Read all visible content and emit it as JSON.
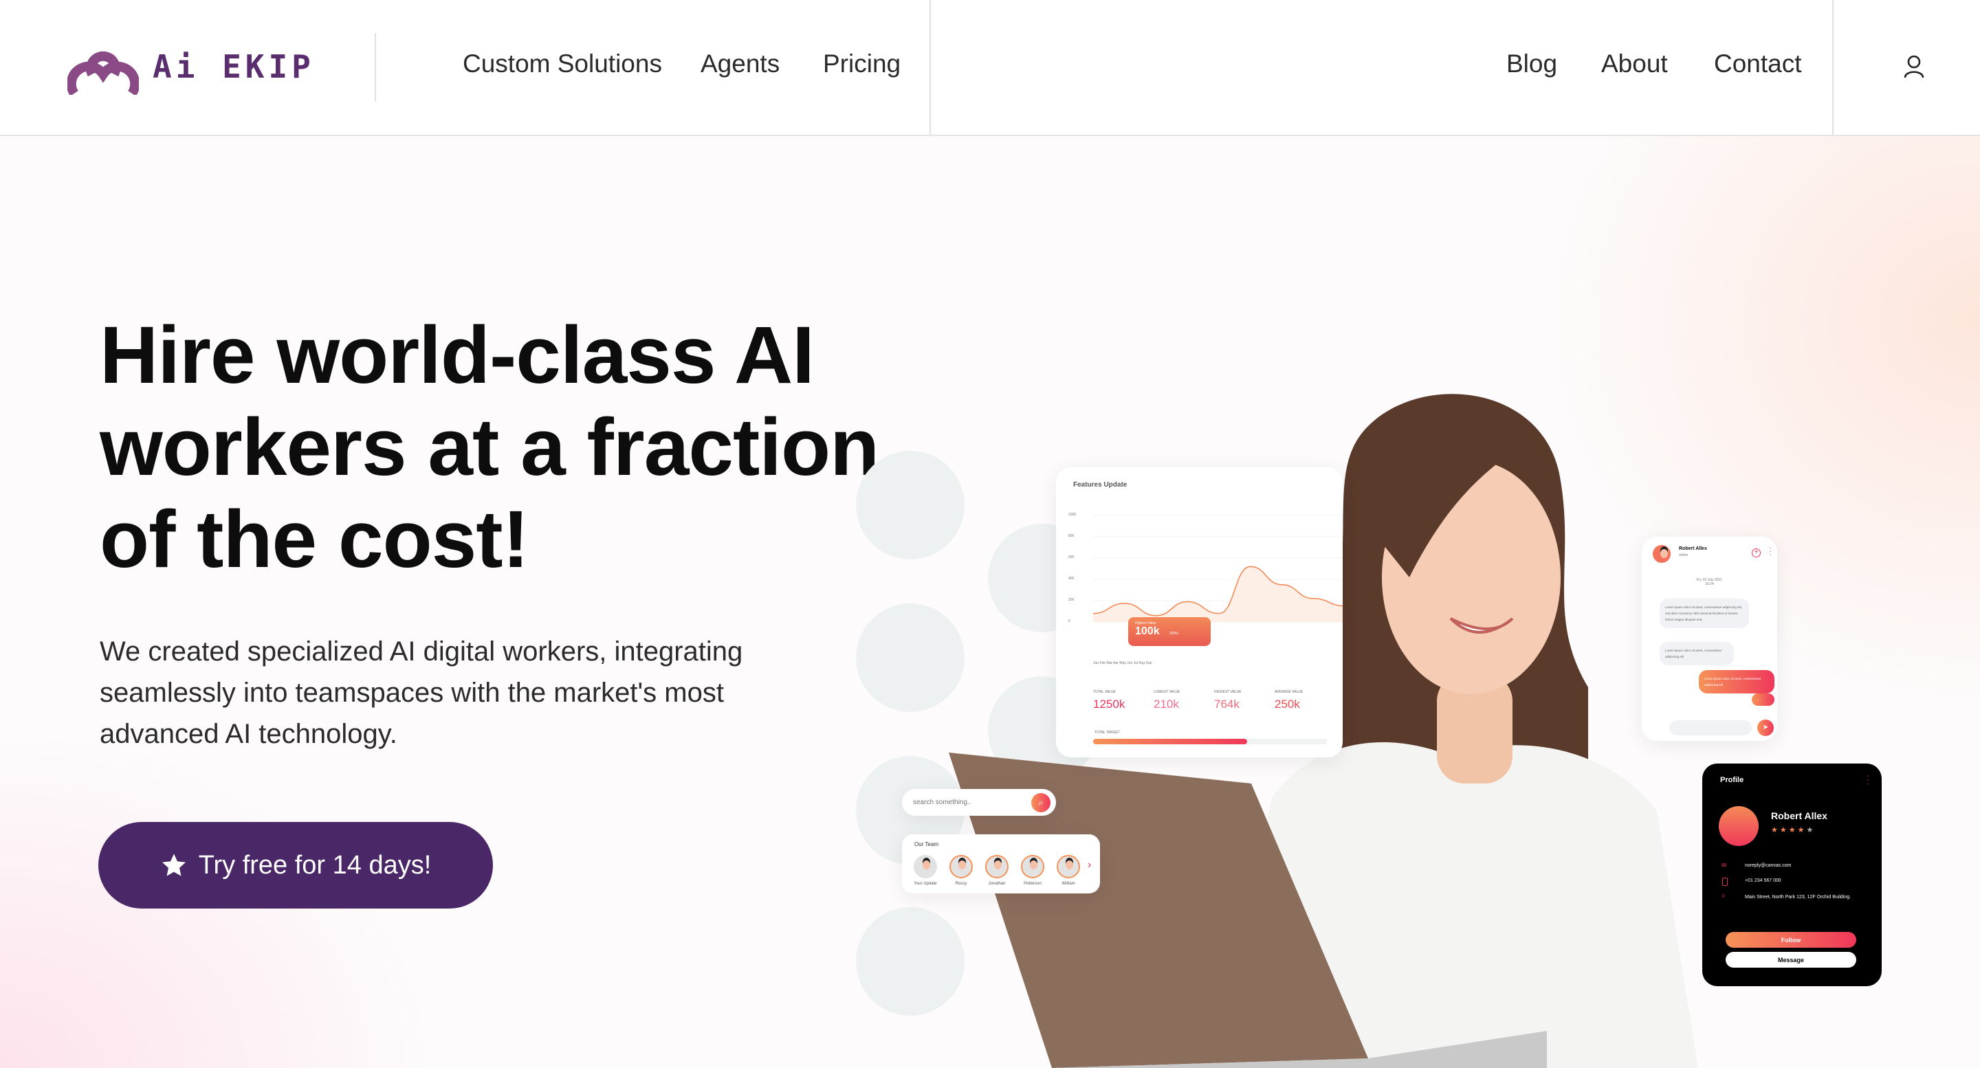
{
  "brand": {
    "name": "Ai EKIP",
    "color": "#7a3f7d",
    "dark": "#4a2766"
  },
  "nav": {
    "left": [
      "Custom Solutions",
      "Agents",
      "Pricing"
    ],
    "right": [
      "Blog",
      "About",
      "Contact"
    ],
    "user_icon": "user-icon"
  },
  "hero": {
    "title": "Hire world-class AI workers at a fraction of the cost!",
    "description": "We created specialized AI digital workers, integrating seamlessly into teamspaces with the market's most advanced AI technology.",
    "cta": {
      "label": "Try free for 14 days!",
      "icon": "star-icon"
    }
  },
  "dashboard": {
    "title": "Features Update",
    "y_ticks": [
      "1000",
      "800",
      "600",
      "400",
      "200",
      "0"
    ],
    "months": "Jan Feb Mar Apr May Jun Jul Aug Sep",
    "tooltip": {
      "label": "Highest Value",
      "value": "100k",
      "pct": "250%"
    },
    "series": [
      80,
      175,
      60,
      190,
      80,
      520,
      350,
      220,
      150
    ],
    "ylim": [
      0,
      1000
    ],
    "stats": [
      {
        "label": "TOTAL VALUE",
        "value": "1250k"
      },
      {
        "label": "LOWEST VALUE",
        "value": "210k"
      },
      {
        "label": "HIGHEST VALUE",
        "value": "764k"
      },
      {
        "label": "AVERAGE VALUE",
        "value": "250k"
      }
    ],
    "target": {
      "label": "TOTAL TARGET",
      "progress": 0.66
    }
  },
  "chat": {
    "name": "Robert Allex",
    "status": "online",
    "date": "Fri, 02 July 2021",
    "time": "15:24",
    "messages": [
      {
        "from": "them",
        "text": "Lorem ipsum dolor sit amet, consectetuer adipiscing elit, sed diam nonummy nibh euismod tincidunt ut laoreet dolore magna aliquam erat."
      },
      {
        "from": "them",
        "text": "Lorem ipsum dolor sit amet, consectetuer adipiscing elit"
      },
      {
        "from": "me",
        "text": "Lorem ipsum dolor sit amet, consectetuer adipiscing elit"
      },
      {
        "from": "me",
        "text": "....."
      }
    ]
  },
  "search": {
    "placeholder": "search something.."
  },
  "team": {
    "title": "Our Team",
    "members": [
      "Your Update",
      "Rossy",
      "Jonathan",
      "Petterson",
      "William"
    ]
  },
  "profile": {
    "title": "Profile",
    "name": "Robert Allex",
    "rating": 4,
    "rating_max": 5,
    "email": "noreply@canvas.com",
    "phone": "+01 234 567 000",
    "address": "Main Street, North Park 123, 12F Orchid Building.",
    "follow": "Follow",
    "message": "Message"
  }
}
